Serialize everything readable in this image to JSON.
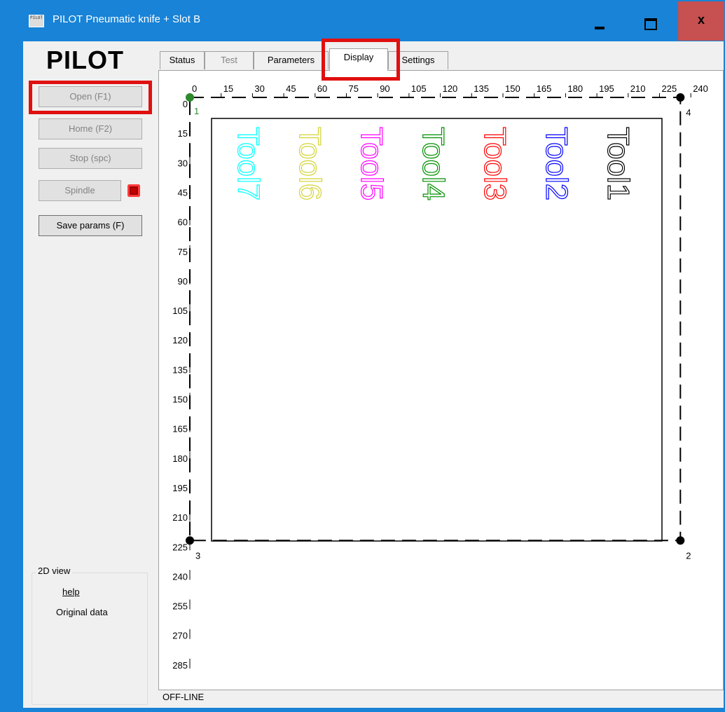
{
  "window": {
    "title": "PILOT Pneumatic knife + Slot B",
    "icon_text": "PILOT",
    "close_glyph": "x"
  },
  "left": {
    "logo": "PILOT",
    "buttons": {
      "open": "Open (F1)",
      "home": "Home (F2)",
      "stop": "Stop (spc)",
      "spindle": "Spindle",
      "save": "Save params (F)"
    },
    "group": {
      "label": "2D view",
      "help": "help",
      "original_data": "Original data"
    }
  },
  "tabs": [
    {
      "label": "Status",
      "state": "normal"
    },
    {
      "label": "Test",
      "state": "disabled"
    },
    {
      "label": "Parameters",
      "state": "normal"
    },
    {
      "label": "Display",
      "state": "active"
    },
    {
      "label": "Settings",
      "state": "normal"
    }
  ],
  "status": "OFF-LINE",
  "view": {
    "x_ticks": [
      "0",
      "15",
      "30",
      "45",
      "60",
      "75",
      "90",
      "105",
      "120",
      "135",
      "150",
      "165",
      "180",
      "195",
      "210",
      "225",
      "240"
    ],
    "y_ticks": [
      "0",
      "15",
      "30",
      "45",
      "60",
      "75",
      "90",
      "105",
      "120",
      "135",
      "150",
      "165",
      "180",
      "195",
      "210",
      "225",
      "240",
      "255",
      "270",
      "285"
    ],
    "corners": [
      "1",
      "2",
      "3",
      "4"
    ],
    "tools": [
      {
        "label": "Tool7",
        "color": "#00ffff"
      },
      {
        "label": "Tool6",
        "color": "#d4d43a"
      },
      {
        "label": "Tool5",
        "color": "#ff00ff"
      },
      {
        "label": "Tool4",
        "color": "#009000"
      },
      {
        "label": "Tool3",
        "color": "#ff0000"
      },
      {
        "label": "Tool2",
        "color": "#0000ff"
      },
      {
        "label": "Tool1",
        "color": "#000000"
      }
    ]
  },
  "colors": {
    "titlebar": "#1883d7",
    "close_button": "#c75050",
    "highlight": "#e01010",
    "origin_point": "#2d8a2d"
  }
}
